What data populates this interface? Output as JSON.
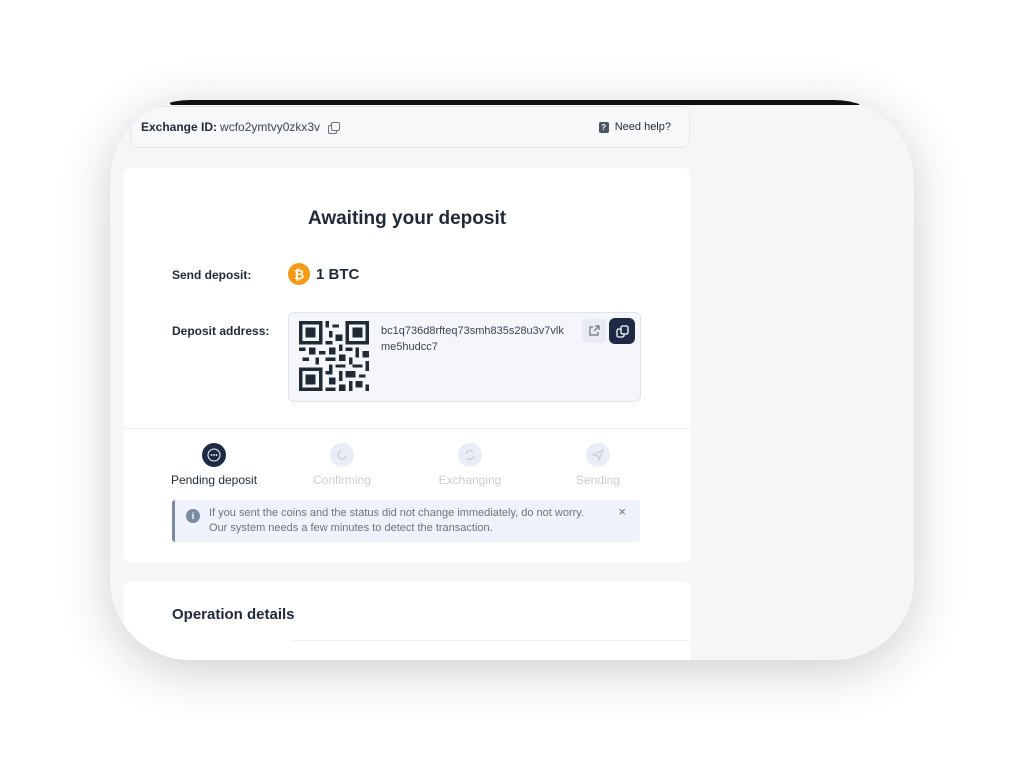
{
  "header": {
    "exchange_id_label": "Exchange ID:",
    "exchange_id_value": "wcfo2ymtvy0zkx3v",
    "help_label": "Need help?"
  },
  "deposit": {
    "title": "Awaiting your deposit",
    "send_label": "Send deposit:",
    "amount": "1 BTC",
    "coin_symbol": "₿",
    "address_label": "Deposit address:",
    "address": "bc1q736d8rfteq73smh835s28u3v7vlkme5hudcc7"
  },
  "steps": [
    {
      "label": "Pending deposit",
      "state": "active"
    },
    {
      "label": "Confirming",
      "state": "pending"
    },
    {
      "label": "Exchanging",
      "state": "pending"
    },
    {
      "label": "Sending",
      "state": "pending"
    }
  ],
  "notice": {
    "text": "If you sent the coins and the status did not change immediately, do not worry. Our system needs a few minutes to detect the transaction.",
    "close": "×"
  },
  "operation": {
    "title": "Operation details"
  },
  "colors": {
    "accent_dark": "#1e2a45",
    "btc_orange": "#f59a12",
    "notice_bg": "#eef3fb"
  }
}
